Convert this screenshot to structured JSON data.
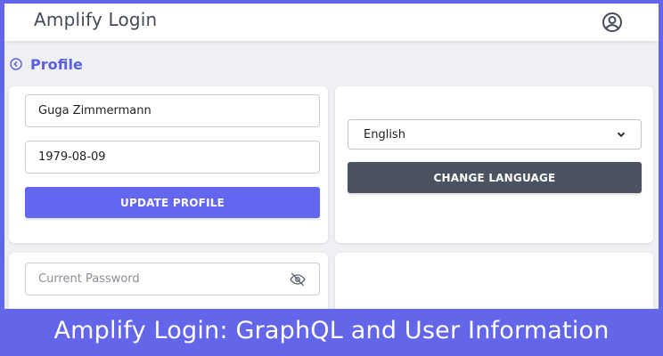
{
  "app": {
    "title": "Amplify Login",
    "user_icon": "account-circle-icon"
  },
  "page": {
    "back_icon": "arrow-left-circle-icon",
    "title": "Profile"
  },
  "profile_form": {
    "name_value": "Guga Zimmermann",
    "birthdate_value": "1979-08-09",
    "update_button": "UPDATE PROFILE"
  },
  "language_form": {
    "selected_language": "English",
    "dropdown_icon": "chevron-down-icon",
    "change_button": "CHANGE LANGUAGE"
  },
  "password_form": {
    "current_password_placeholder": "Current Password",
    "visibility_icon": "eye-off-icon"
  },
  "caption": "Amplify Login: GraphQL and User Information",
  "colors": {
    "accent": "#6366f1",
    "frame_border": "#6466e9",
    "secondary_button": "#4b5260"
  }
}
